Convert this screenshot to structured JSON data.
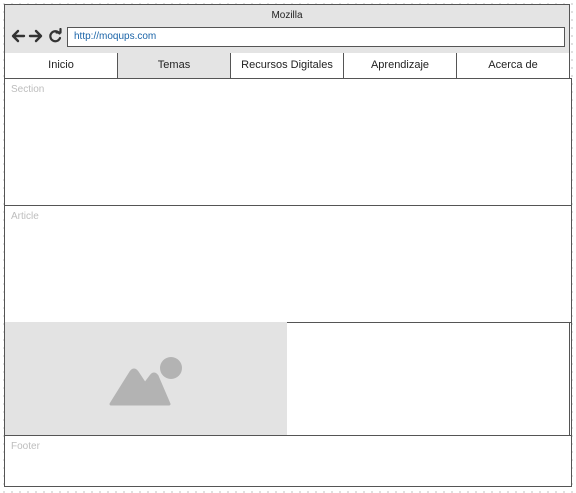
{
  "window": {
    "title": "Mozilla"
  },
  "address_bar": {
    "url": "http://moqups.com"
  },
  "nav_buttons": {
    "back_icon": "arrow-left-icon",
    "forward_icon": "arrow-right-icon",
    "reload_icon": "reload-icon"
  },
  "tabs": [
    {
      "label": "Inicio",
      "active": false
    },
    {
      "label": "Temas",
      "active": true
    },
    {
      "label": "Recursos Digitales",
      "active": false
    },
    {
      "label": "Aprendizaje",
      "active": false
    },
    {
      "label": "Acerca de",
      "active": false
    }
  ],
  "regions": {
    "section_label": "Section",
    "article_label": "Article",
    "footer_label": "Footer"
  },
  "image_placeholder": {
    "icon": "image-icon"
  },
  "colors": {
    "chrome_bg": "#e4e4e4",
    "border": "#555555",
    "url_text": "#1a64a8",
    "placeholder_label": "#bdbdbd",
    "image_bg": "#e3e3e3",
    "image_icon": "#b3b3b3"
  }
}
